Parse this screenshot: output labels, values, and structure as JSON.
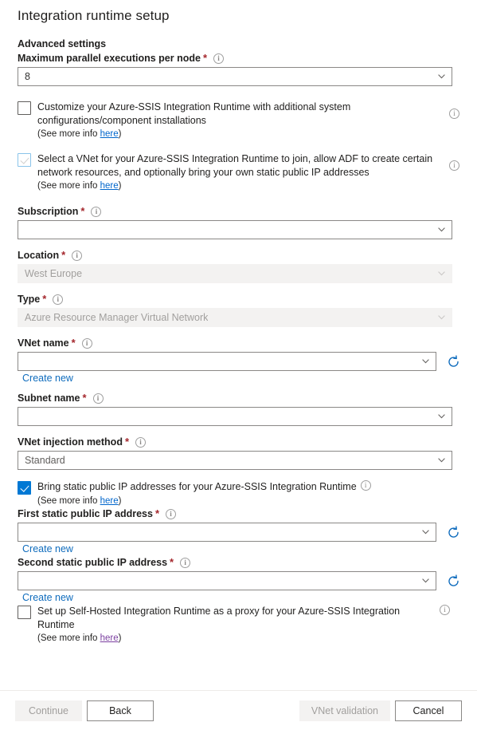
{
  "page": {
    "title": "Integration runtime setup",
    "section_heading": "Advanced settings"
  },
  "icons": {
    "info": "i",
    "chevron_down": "chevron-down-icon",
    "refresh": "refresh-icon"
  },
  "fields": {
    "max_parallel": {
      "label": "Maximum parallel executions per node",
      "required": "*",
      "value": "8"
    },
    "subscription": {
      "label": "Subscription",
      "required": "*",
      "value": ""
    },
    "location": {
      "label": "Location",
      "required": "*",
      "value": "West Europe"
    },
    "type": {
      "label": "Type",
      "required": "*",
      "value": "Azure Resource Manager Virtual Network"
    },
    "vnet_name": {
      "label": "VNet name",
      "required": "*",
      "value": "",
      "create_new": "Create new"
    },
    "subnet_name": {
      "label": "Subnet name",
      "required": "*",
      "value": ""
    },
    "vnet_injection": {
      "label": "VNet injection method",
      "required": "*",
      "value": "Standard"
    },
    "first_ip": {
      "label": "First static public IP address",
      "required": "*",
      "value": "",
      "create_new": "Create new"
    },
    "second_ip": {
      "label": "Second static public IP address",
      "required": "*",
      "value": "",
      "create_new": "Create new"
    }
  },
  "checkboxes": {
    "customize": {
      "label": "Customize your Azure-SSIS Integration Runtime with additional system configurations/component installations",
      "checked": false,
      "see_more_prefix": "(See more info ",
      "see_more_link": "here",
      "see_more_suffix": ")"
    },
    "select_vnet": {
      "label": "Select a VNet for your Azure-SSIS Integration Runtime to join, allow ADF to create certain network resources, and optionally bring your own static public IP addresses",
      "checked": true,
      "see_more_prefix": "(See more info ",
      "see_more_link": "here",
      "see_more_suffix": ")"
    },
    "bring_static_ip": {
      "label": "Bring static public IP addresses for your Azure-SSIS Integration Runtime",
      "checked": true,
      "see_more_prefix": "(See more info ",
      "see_more_link": "here",
      "see_more_suffix": ")"
    },
    "self_hosted_proxy": {
      "label": "Set up Self-Hosted Integration Runtime as a proxy for your Azure-SSIS Integration Runtime",
      "checked": false,
      "see_more_prefix": "(See more info ",
      "see_more_link": "here",
      "see_more_suffix": ")"
    }
  },
  "footer": {
    "continue_label": "Continue",
    "back_label": "Back",
    "vnet_validation_label": "VNet validation",
    "cancel_label": "Cancel"
  },
  "colors": {
    "accent": "#0078d4",
    "link": "#0f6cbd",
    "required": "#a4262c",
    "disabled_bg": "#f3f2f1",
    "border": "#8a8886"
  }
}
